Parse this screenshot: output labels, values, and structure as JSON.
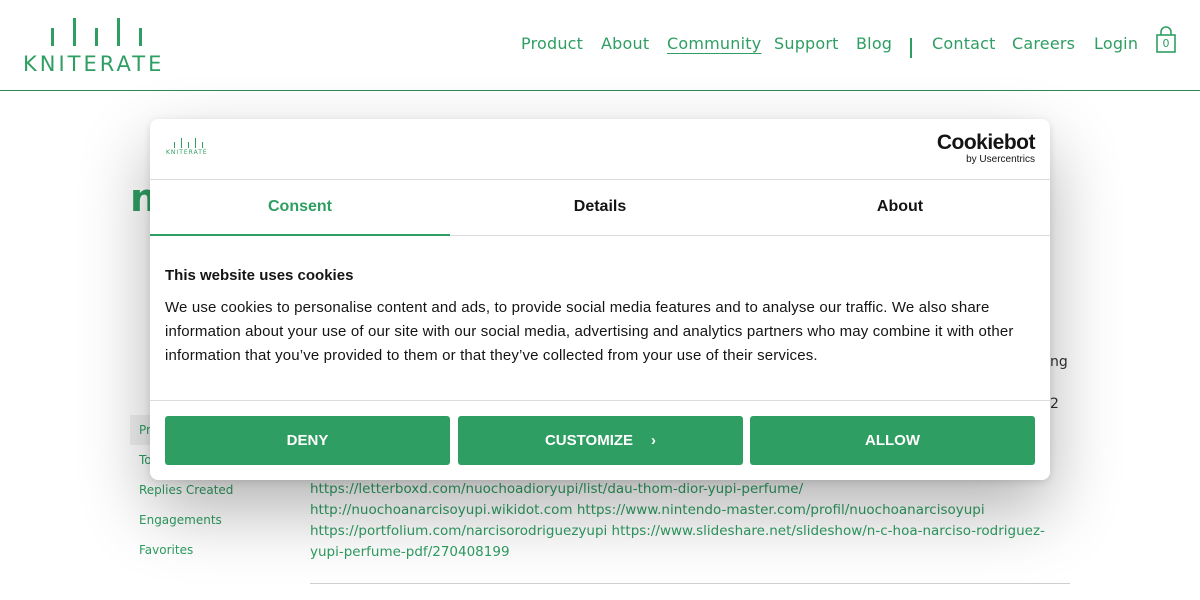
{
  "site": {
    "logo_text": "KNITERATE",
    "nav": [
      {
        "label": "Product",
        "active": false
      },
      {
        "label": "About",
        "active": false
      },
      {
        "label": "Community",
        "active": true
      },
      {
        "label": "Support",
        "active": false
      },
      {
        "label": "Blog",
        "active": false
      },
      {
        "label": "Contact",
        "active": false
      },
      {
        "label": "Careers",
        "active": false
      },
      {
        "label": "Login",
        "active": false
      }
    ],
    "cart_count": "0",
    "accent_color": "#2e9e62"
  },
  "background_page": {
    "heading_fragment": "n",
    "side_menu": [
      "Pr",
      "To",
      "Replies Created",
      "Engagements",
      "Favorites"
    ],
    "right_fragments": [
      "ng",
      "2"
    ],
    "links_text": "https://letterboxd.com/nuochoadioryupi/list/dau-thom-dior-yupi-perfume/ http://nuochoanarcisoyupi.wikidot.com https://www.nintendo-master.com/profil/nuochoanarcisoyupi https://portfolium.com/narcisorodriguezyupi https://www.slideshare.net/slideshow/n-c-hoa-narciso-rodriguez-yupi-perfume-pdf/270408199"
  },
  "cookie_dialog": {
    "logo_text": "KNITERATE",
    "brand_name": "Cookiebot",
    "brand_sub": "by Usercentrics",
    "tabs": [
      "Consent",
      "Details",
      "About"
    ],
    "active_tab": "Consent",
    "title": "This website uses cookies",
    "body": "We use cookies to personalise content and ads, to provide social media features and to analyse our traffic. We also share information about your use of our site with our social media, advertising and analytics partners who may combine it with other information that you’ve provided to them or that they’ve collected from your use of their services.",
    "buttons": {
      "deny": "DENY",
      "customize": "CUSTOMIZE",
      "allow": "ALLOW"
    },
    "button_color": "#2e9e62"
  }
}
